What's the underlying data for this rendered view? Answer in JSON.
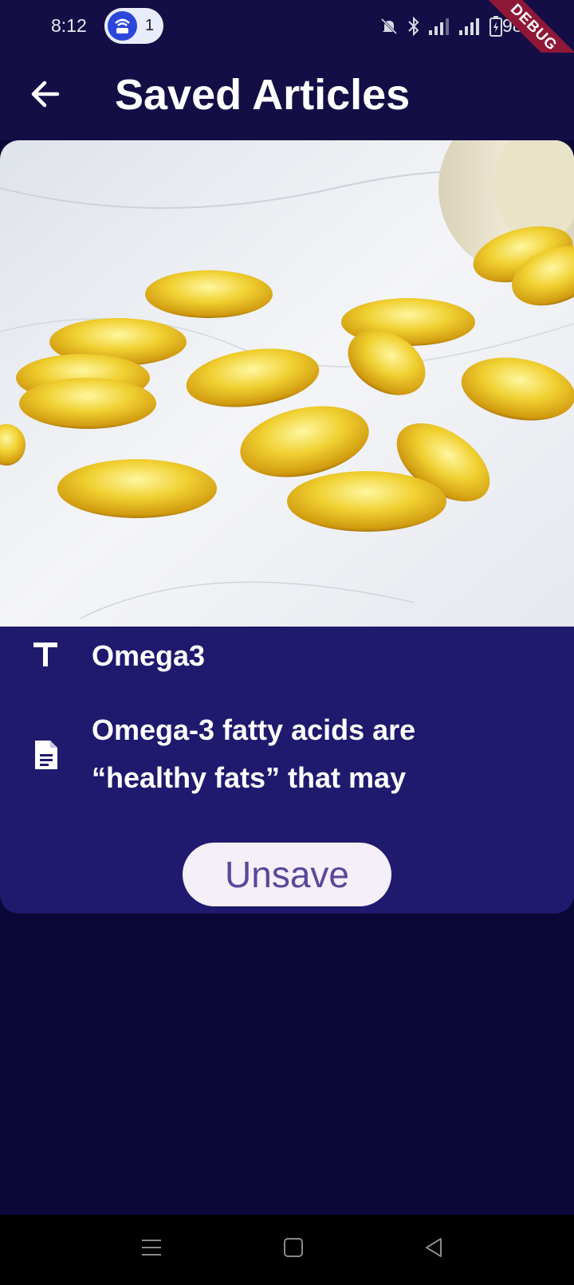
{
  "status_bar": {
    "time": "8:12",
    "hotspot_count": "1",
    "battery": "98%",
    "debug_label": "DEBUG",
    "icons": [
      "hotspot-icon",
      "mute-bell-icon",
      "bluetooth-icon",
      "signal-icon",
      "signal-icon",
      "battery-charging-icon"
    ]
  },
  "app_bar": {
    "title": "Saved Articles",
    "back_icon": "arrow-left-icon"
  },
  "article": {
    "image": "omega-3 fish oil softgel capsules on marble",
    "title_icon": "text-T-icon",
    "title": "Omega3",
    "desc_icon": "document-icon",
    "description": "Omega-3 fatty acids are “healthy fats” that may",
    "unsave_label": "Unsave"
  },
  "nav_bar": {
    "items": [
      "menu-icon",
      "home-square-icon",
      "back-triangle-icon"
    ]
  },
  "colors": {
    "background": "#0b0838",
    "app_bar": "#130e45",
    "card": "#1f1a6e",
    "button_bg": "#f4eff8",
    "button_text": "#5b4698",
    "debug_ribbon": "#8f1838"
  }
}
